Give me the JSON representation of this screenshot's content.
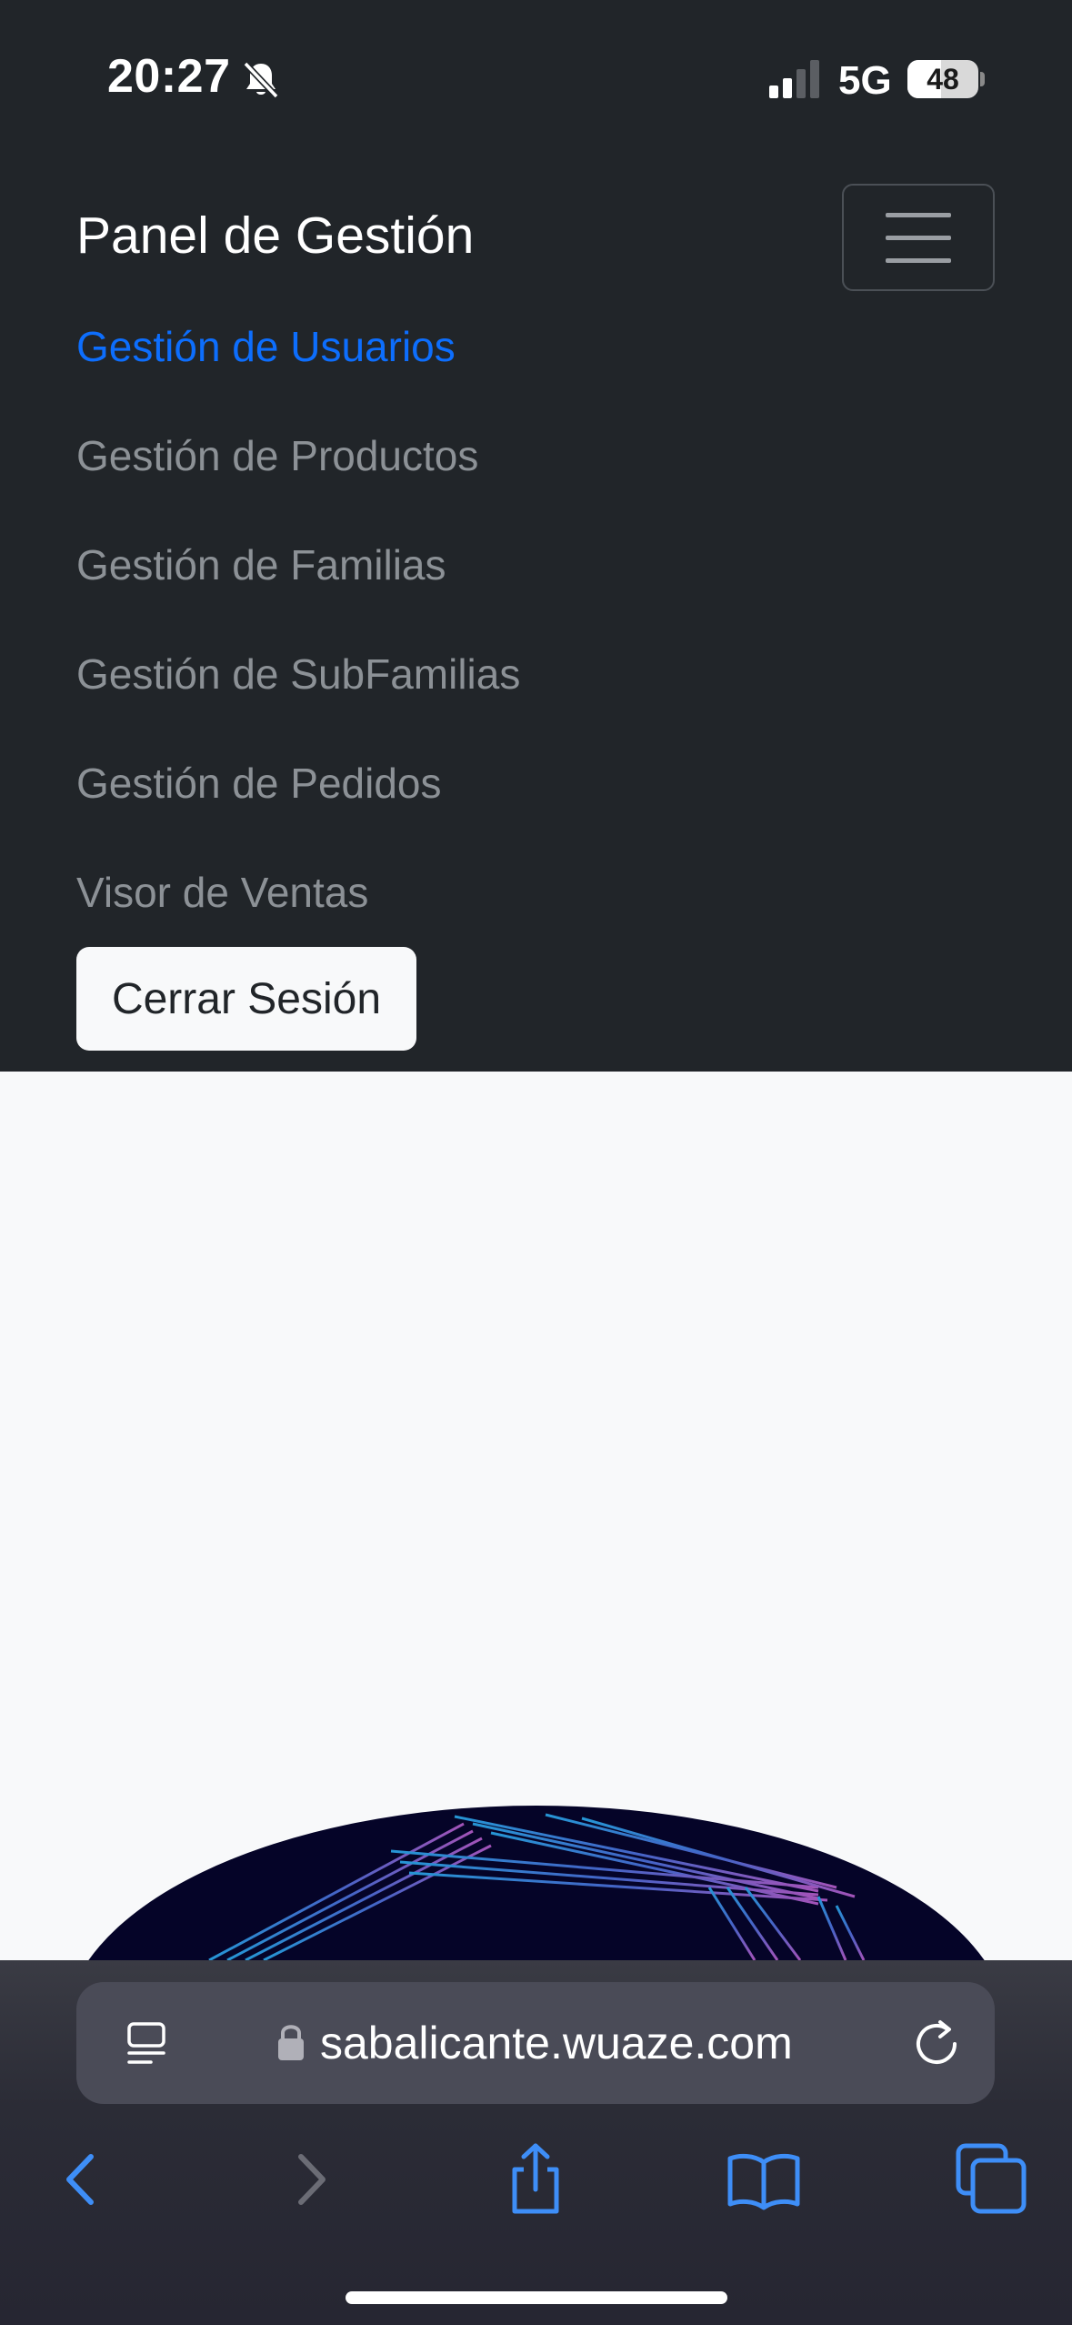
{
  "status_bar": {
    "time": "20:27",
    "network": "5G",
    "battery_level": 48,
    "battery_label": "48"
  },
  "navbar": {
    "brand": "Panel de Gestión",
    "items": [
      {
        "label": "Gestión de Usuarios",
        "active": true
      },
      {
        "label": "Gestión de Productos",
        "active": false
      },
      {
        "label": "Gestión de Familias",
        "active": false
      },
      {
        "label": "Gestión de SubFamilias",
        "active": false
      },
      {
        "label": "Gestión de Pedidos",
        "active": false
      },
      {
        "label": "Visor de Ventas",
        "active": false
      }
    ],
    "logout_label": "Cerrar Sesión"
  },
  "browser": {
    "url": "sabalicante.wuaze.com"
  },
  "colors": {
    "navbar_bg": "#212529",
    "active_link": "#0d6efd",
    "inactive_link": "#8c9196",
    "page_bg": "#f8f9fa",
    "safari_icon_blue": "#3e8ef7"
  }
}
